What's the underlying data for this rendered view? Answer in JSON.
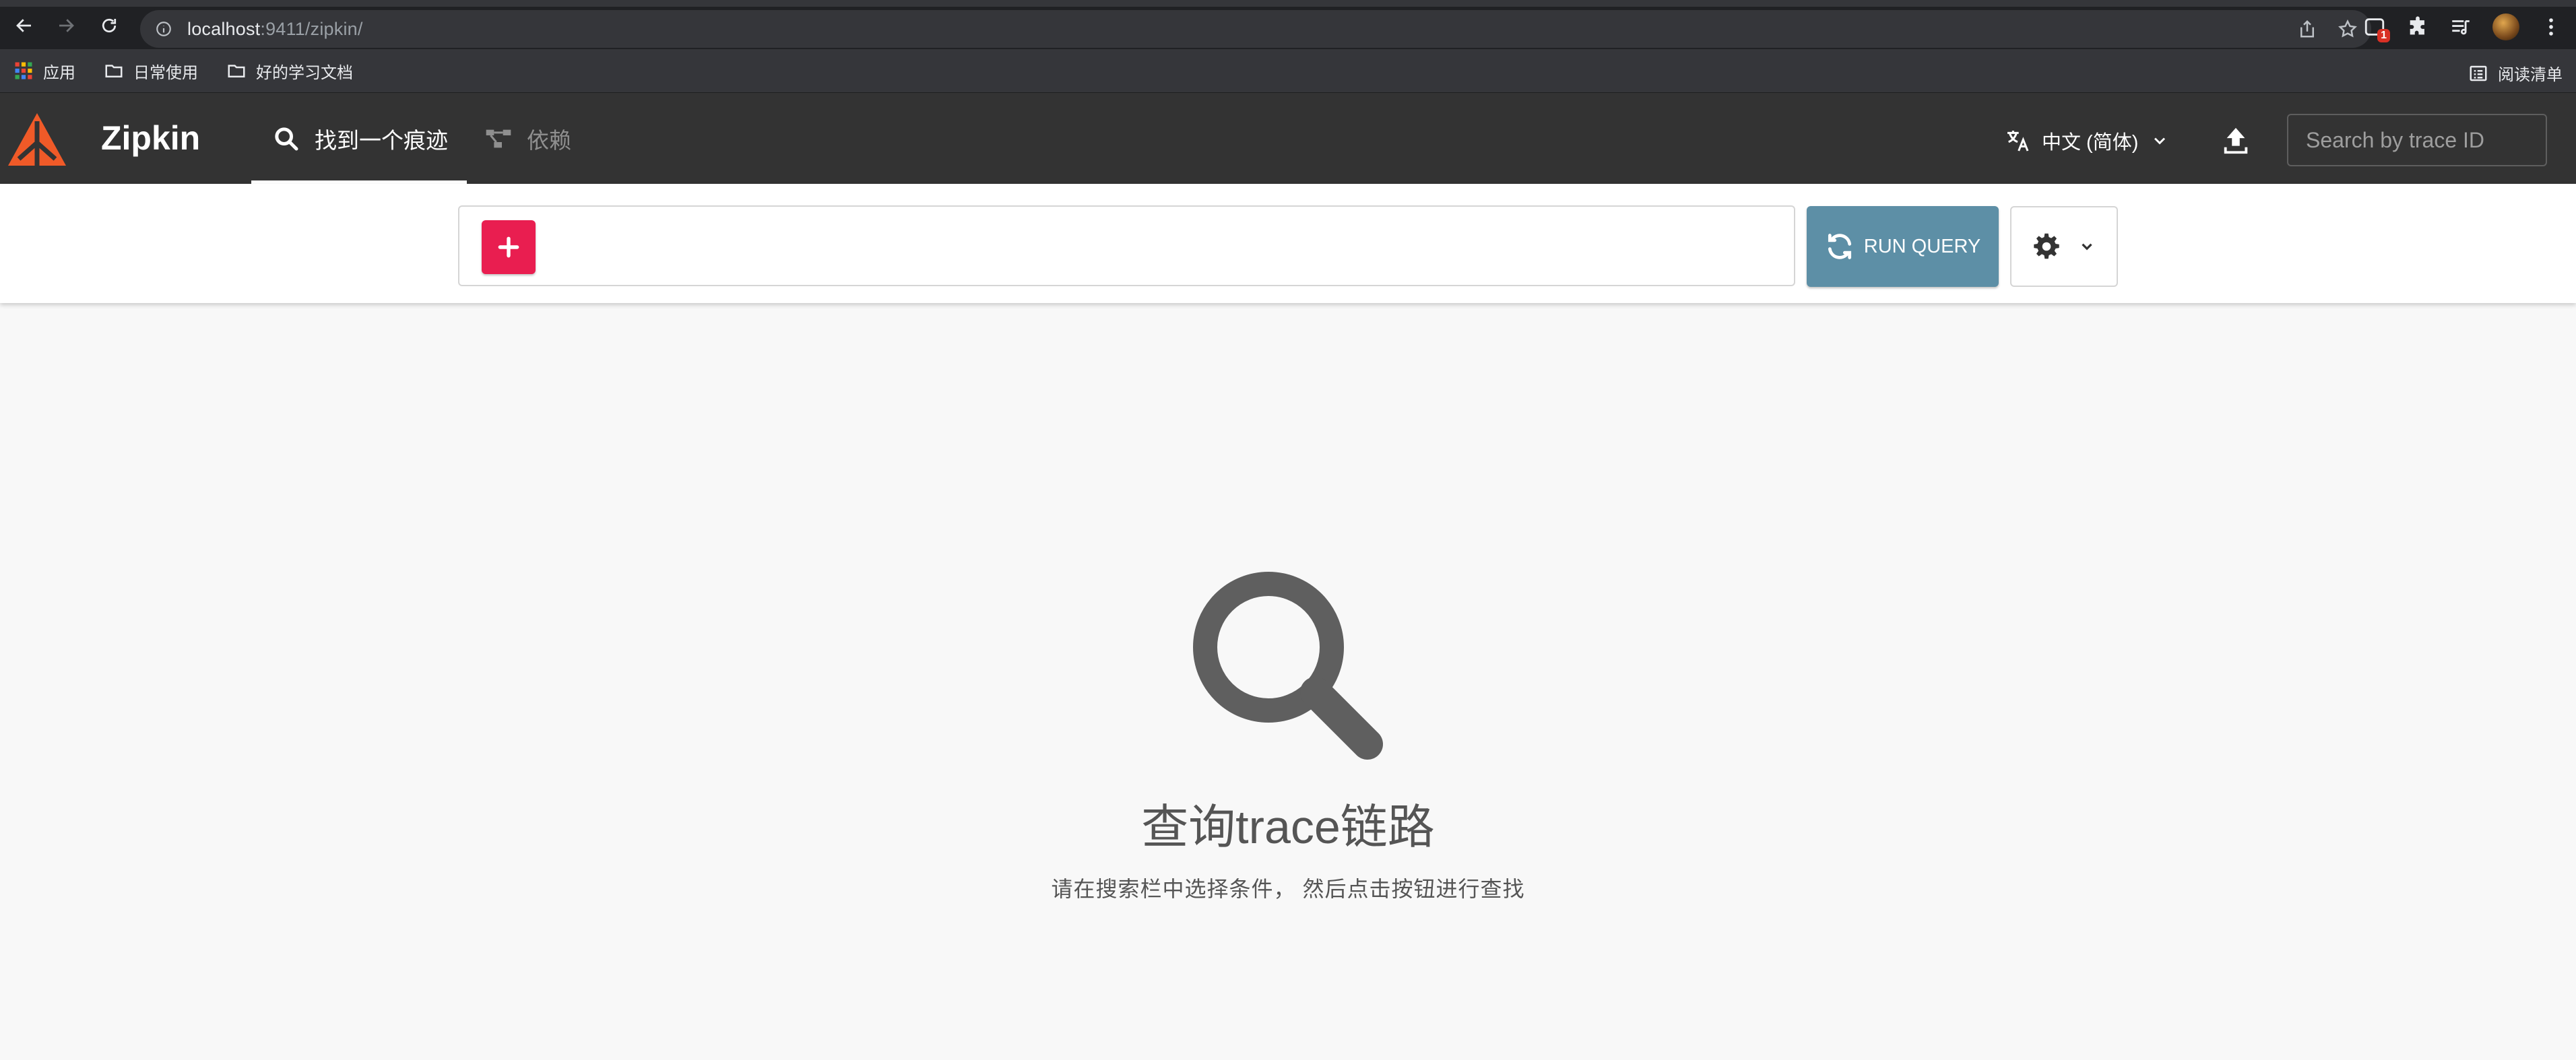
{
  "browser": {
    "url_host": "localhost",
    "url_path": ":9411/zipkin/",
    "extension_badge": "1",
    "bookmarks": [
      {
        "label": "应用",
        "icon": "apps-grid-icon"
      },
      {
        "label": "日常使用",
        "icon": "folder-icon"
      },
      {
        "label": "好的学习文档",
        "icon": "folder-icon"
      }
    ],
    "reading_list": "阅读清单"
  },
  "header": {
    "brand": "Zipkin",
    "tabs": [
      {
        "label": "找到一个痕迹",
        "icon": "search-icon",
        "active": true
      },
      {
        "label": "依赖",
        "icon": "dependency-graph-icon",
        "active": false
      }
    ],
    "language": "中文 (简体)",
    "trace_search_placeholder": "Search by trace ID"
  },
  "query": {
    "add_label": "+",
    "run_label": "RUN QUERY"
  },
  "empty_state": {
    "title": "查询trace链路",
    "description": "请在搜索栏中选择条件， 然后点击按钮进行查找"
  },
  "colors": {
    "header_bg": "#333333",
    "add_button": "#e91e50",
    "run_button": "#5d8fa6",
    "logo_orange": "#f05a28"
  }
}
